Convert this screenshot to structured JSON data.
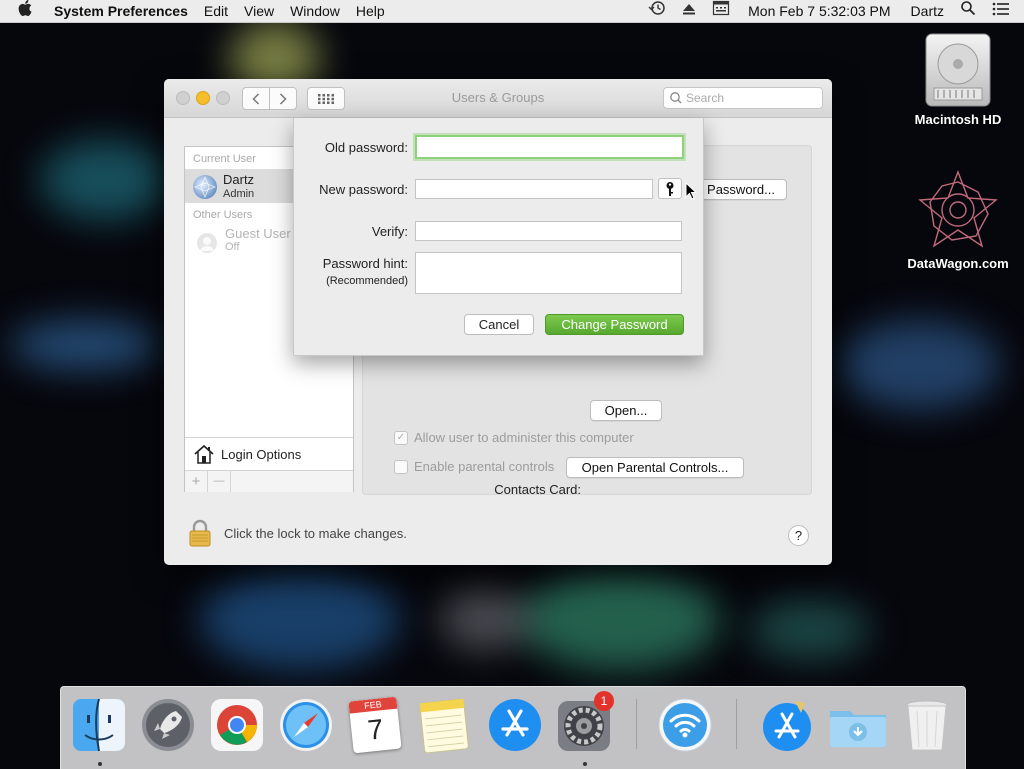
{
  "menubar": {
    "app_name": "System Preferences",
    "menus": [
      "Edit",
      "View",
      "Window",
      "Help"
    ],
    "clock": "Mon Feb 7  5:32:03 PM",
    "user": "Dartz"
  },
  "desktop": {
    "icons": [
      {
        "label": "Macintosh HD",
        "icon": "hard-drive-icon"
      },
      {
        "label": "DataWagon.com",
        "icon": "star-pattern-icon"
      }
    ]
  },
  "window": {
    "title": "Users & Groups",
    "search_placeholder": "Search",
    "users": {
      "current_header": "Current User",
      "current_name": "Dartz",
      "current_role": "Admin",
      "other_header": "Other Users",
      "guest_name": "Guest User",
      "guest_status": "Off"
    },
    "login_options": "Login Options",
    "add_symbol": "+",
    "remove_symbol": "—",
    "password_button": "Password...",
    "contacts_card_label": "Contacts Card:",
    "open_button": "Open...",
    "allow_admin_label": "Allow user to administer this computer",
    "allow_admin_checked": true,
    "parental_label": "Enable parental controls",
    "parental_checked": false,
    "open_parental_button": "Open Parental Controls...",
    "lock_text": "Click the lock to make changes.",
    "help_symbol": "?"
  },
  "sheet": {
    "old_password_label": "Old password:",
    "new_password_label": "New password:",
    "verify_label": "Verify:",
    "hint_label": "Password hint:",
    "hint_sublabel": "(Recommended)",
    "old_password_value": "",
    "new_password_value": "",
    "verify_value": "",
    "hint_value": "",
    "cancel_button": "Cancel",
    "change_button": "Change Password"
  },
  "dock": {
    "items": [
      "Finder",
      "Launchpad",
      "Chrome",
      "Safari",
      "Calendar",
      "Notes",
      "App Store",
      "System Preferences",
      "Wireless Diagnostics",
      "App Store",
      "Downloads",
      "Trash"
    ],
    "calendar_month": "FEB",
    "calendar_day": "7",
    "sysprefs_badge": "1"
  },
  "colors": {
    "accent_green": "#58a82f",
    "focus_ring": "#8fd07a",
    "badge_red": "#e3322b"
  }
}
